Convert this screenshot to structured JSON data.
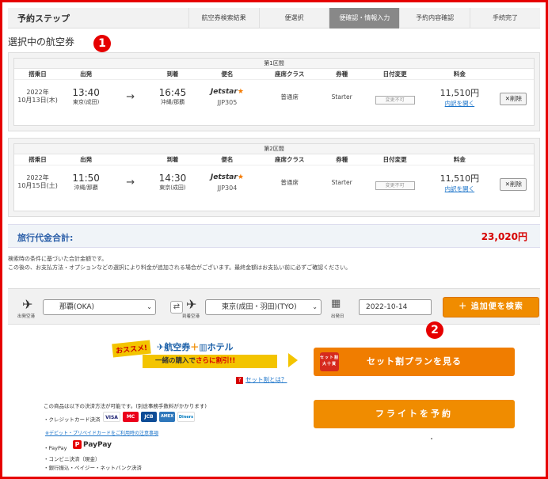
{
  "steps": {
    "label": "予約ステップ",
    "items": [
      "航空券検索結果",
      "便選択",
      "便確認・情報入力",
      "予約内容確認",
      "手続完了"
    ],
    "active_index": 2
  },
  "selected_title": "選択中の航空券",
  "markers": [
    "1",
    "2"
  ],
  "columns": [
    "搭乗日",
    "出発",
    "到着",
    "便名",
    "座席クラス",
    "券種",
    "日付変更",
    "料金"
  ],
  "segments": [
    {
      "header": "第1区間",
      "date_year": "2022年",
      "date_day": "10月13日(木)",
      "dep_time": "13:40",
      "dep_place": "東京(成田)",
      "arr_time": "16:45",
      "arr_place": "沖縄/那覇",
      "airline": "Jetstar",
      "flight_no": "JJP305",
      "seat_class": "普通席",
      "fare_type": "Starter",
      "date_change": "変更不可",
      "price": "11,510円",
      "details": "内訳を開く",
      "delete": "削除"
    },
    {
      "header": "第2区間",
      "date_year": "2022年",
      "date_day": "10月15日(土)",
      "dep_time": "11:50",
      "dep_place": "沖縄/那覇",
      "arr_time": "14:30",
      "arr_place": "東京(成田)",
      "airline": "Jetstar",
      "flight_no": "JJP304",
      "seat_class": "普通席",
      "fare_type": "Starter",
      "date_change": "変更不可",
      "price": "11,510円",
      "details": "内訳を開く",
      "delete": "削除"
    }
  ],
  "total": {
    "label": "旅行代金合計:",
    "amount": "23,020円"
  },
  "notes": [
    "検索時の条件に基づいた合計金額です。",
    "この後の、お支払方法・オプションなどの選択により料金が追加される場合がございます。最終金額はお支払い前に必ずご確認ください。"
  ],
  "search": {
    "dep_caption": "出発空港",
    "dep_value": "那覇(OKA)",
    "arr_caption": "到着空港",
    "arr_value": "東京(成田・羽田)(TYO)",
    "date_caption": "出発日",
    "date_value": "2022-10-14",
    "add_button": "＋  追加便を検索"
  },
  "promo": {
    "badge": "おススメ!",
    "line1_a": "航空券",
    "line1_plus": "＋",
    "line1_b": "ホテル",
    "line2_a": "一緒の購入で",
    "line2_b": "さらに割引!!",
    "what_is": "セット割とは？",
    "set_button": "セット割プランを見る",
    "set_badge": "セット割 大十買"
  },
  "flight_button": "フライトを予約",
  "payment": {
    "intro": "この商品は以下の決済方法が可能です。(別途事務手数料がかかります)",
    "credit": "・クレジットカード決済",
    "card_brands": [
      "VISA",
      "MC",
      "JCB",
      "AMEX",
      "Diners"
    ],
    "debit_link": "※デビット・プリペイドカードをご利用時の注意事項",
    "paypay_label": "・PayPay",
    "paypay_logo": "PayPay",
    "convenience": "・コンビニ決済（現金）",
    "bank": "・銀行振込・ペイジー・ネットバンク決済"
  },
  "colors": {
    "accent": "#f08c00",
    "frame": "#e60000",
    "link": "#1a73c9",
    "active_step": "#888888"
  }
}
